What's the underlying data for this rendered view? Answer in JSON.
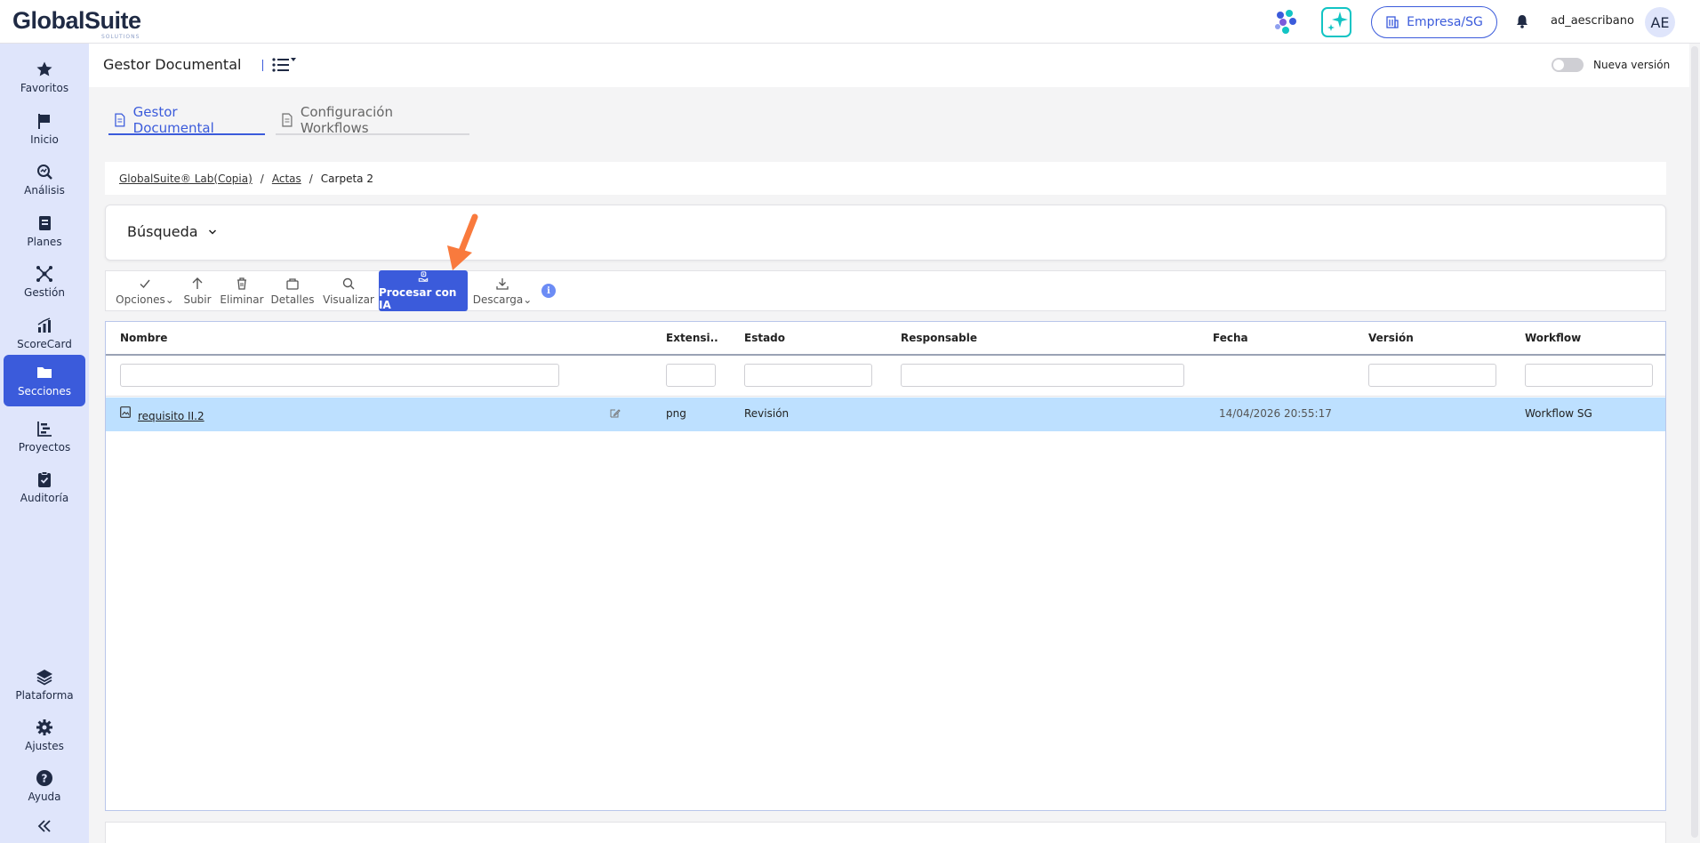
{
  "app": {
    "logo_text": "GlobalSuite",
    "logo_sub": "SOLUTIONS",
    "company_label": "Empresa/SG",
    "username": "ad_aescribano",
    "avatar_initials": "AE",
    "accent": "#3b5bdb"
  },
  "sidebar": {
    "items": [
      {
        "label": "Favoritos",
        "icon": "star-icon"
      },
      {
        "label": "Inicio",
        "icon": "flag-icon"
      },
      {
        "label": "Análisis",
        "icon": "analysis-icon"
      },
      {
        "label": "Planes",
        "icon": "plans-icon"
      },
      {
        "label": "Gestión",
        "icon": "network-icon"
      },
      {
        "label": "ScoreCard",
        "icon": "chart-icon"
      },
      {
        "label": "Secciones",
        "icon": "folder-icon"
      },
      {
        "label": "Proyectos",
        "icon": "gantt-icon"
      },
      {
        "label": "Auditoría",
        "icon": "clipboard-check-icon"
      },
      {
        "label": "Plataforma",
        "icon": "layers-icon"
      },
      {
        "label": "Ajustes",
        "icon": "gear-icon"
      },
      {
        "label": "Ayuda",
        "icon": "help-icon"
      }
    ],
    "active": "Secciones"
  },
  "header": {
    "title": "Gestor Documental",
    "toggle_label": "Nueva versión"
  },
  "tabs": [
    {
      "label": "Gestor Documental",
      "active": true
    },
    {
      "label": "Configuración Workflows",
      "active": false
    }
  ],
  "breadcrumb": {
    "items": [
      "GlobalSuite® Lab(Copia)",
      "Actas",
      "Carpeta 2"
    ]
  },
  "search": {
    "title": "Búsqueda"
  },
  "toolbar": {
    "buttons": [
      {
        "label": "Opciones",
        "icon": "check-icon",
        "dropdown": true
      },
      {
        "label": "Subir",
        "icon": "arrow-up-icon"
      },
      {
        "label": "Eliminar",
        "icon": "trash-icon"
      },
      {
        "label": "Detalles",
        "icon": "details-icon"
      },
      {
        "label": "Visualizar",
        "icon": "search-icon"
      },
      {
        "label": "Procesar con IA",
        "icon": "ai-hand-icon",
        "primary": true
      },
      {
        "label": "Descarga",
        "icon": "download-icon",
        "dropdown": true
      }
    ],
    "info": "i"
  },
  "table": {
    "columns": [
      "Nombre",
      "Extensi...",
      "Estado",
      "Responsable",
      "Fecha",
      "Versión",
      "Workflow"
    ],
    "rows": [
      {
        "nombre": "requisito II.2",
        "extension": "png",
        "estado": "Revisión",
        "responsable": "",
        "fecha": "14/04/2026 20:55:17",
        "version": "",
        "workflow": "Workflow SG"
      }
    ]
  }
}
